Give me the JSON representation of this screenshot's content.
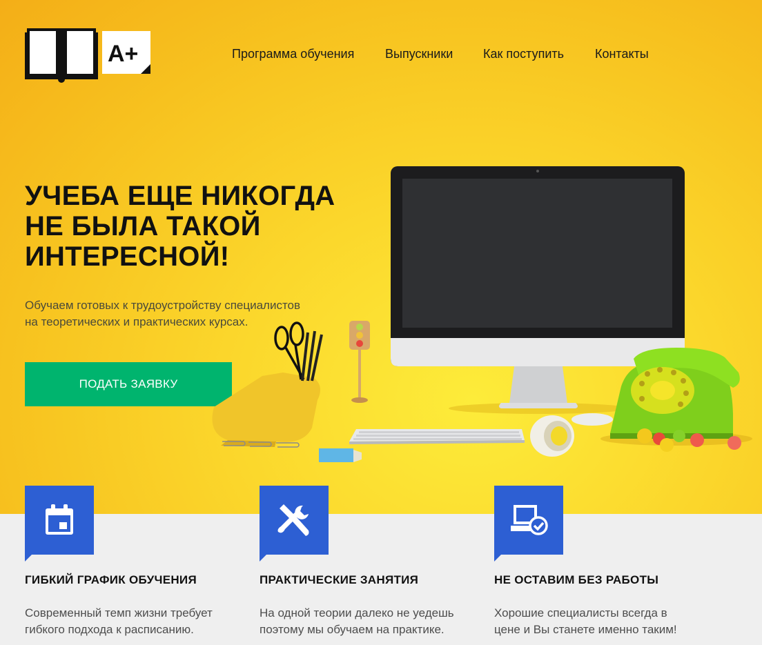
{
  "logo": {
    "text": "A+"
  },
  "nav": {
    "items": [
      "Программа обучения",
      "Выпускники",
      "Как поступить",
      "Контакты"
    ]
  },
  "hero": {
    "headline_lines": [
      "УЧЕБА ЕЩЕ НИКОГДА",
      "НЕ БЫЛА ТАКОЙ",
      "ИНТЕРЕСНОЙ!"
    ],
    "subtitle_lines": [
      "Обучаем готовых к трудоустройству специалистов",
      "на теоретических и практических курсах."
    ],
    "cta_label": "ПОДАТЬ ЗАЯВКУ"
  },
  "features": [
    {
      "icon": "calendar-icon",
      "title": "ГИБКИЙ ГРАФИК ОБУЧЕНИЯ",
      "text_lines": [
        "Современный темп жизни требует",
        "гибкого подхода к расписанию."
      ]
    },
    {
      "icon": "tools-icon",
      "title": "ПРАКТИЧЕСКИЕ ЗАНЯТИЯ",
      "text_lines": [
        "На одной теории далеко не уедешь",
        "поэтому мы обучаем на практике."
      ]
    },
    {
      "icon": "laptop-check-icon",
      "title": "НЕ ОСТАВИМ БЕЗ РАБОТЫ",
      "text_lines": [
        "Хорошие специалисты всегда в",
        "цене и Вы станете именно таким!"
      ]
    }
  ],
  "colors": {
    "accent": "#00b46e",
    "badge": "#2d5fd3",
    "hero_bg": "#fbd62b"
  }
}
